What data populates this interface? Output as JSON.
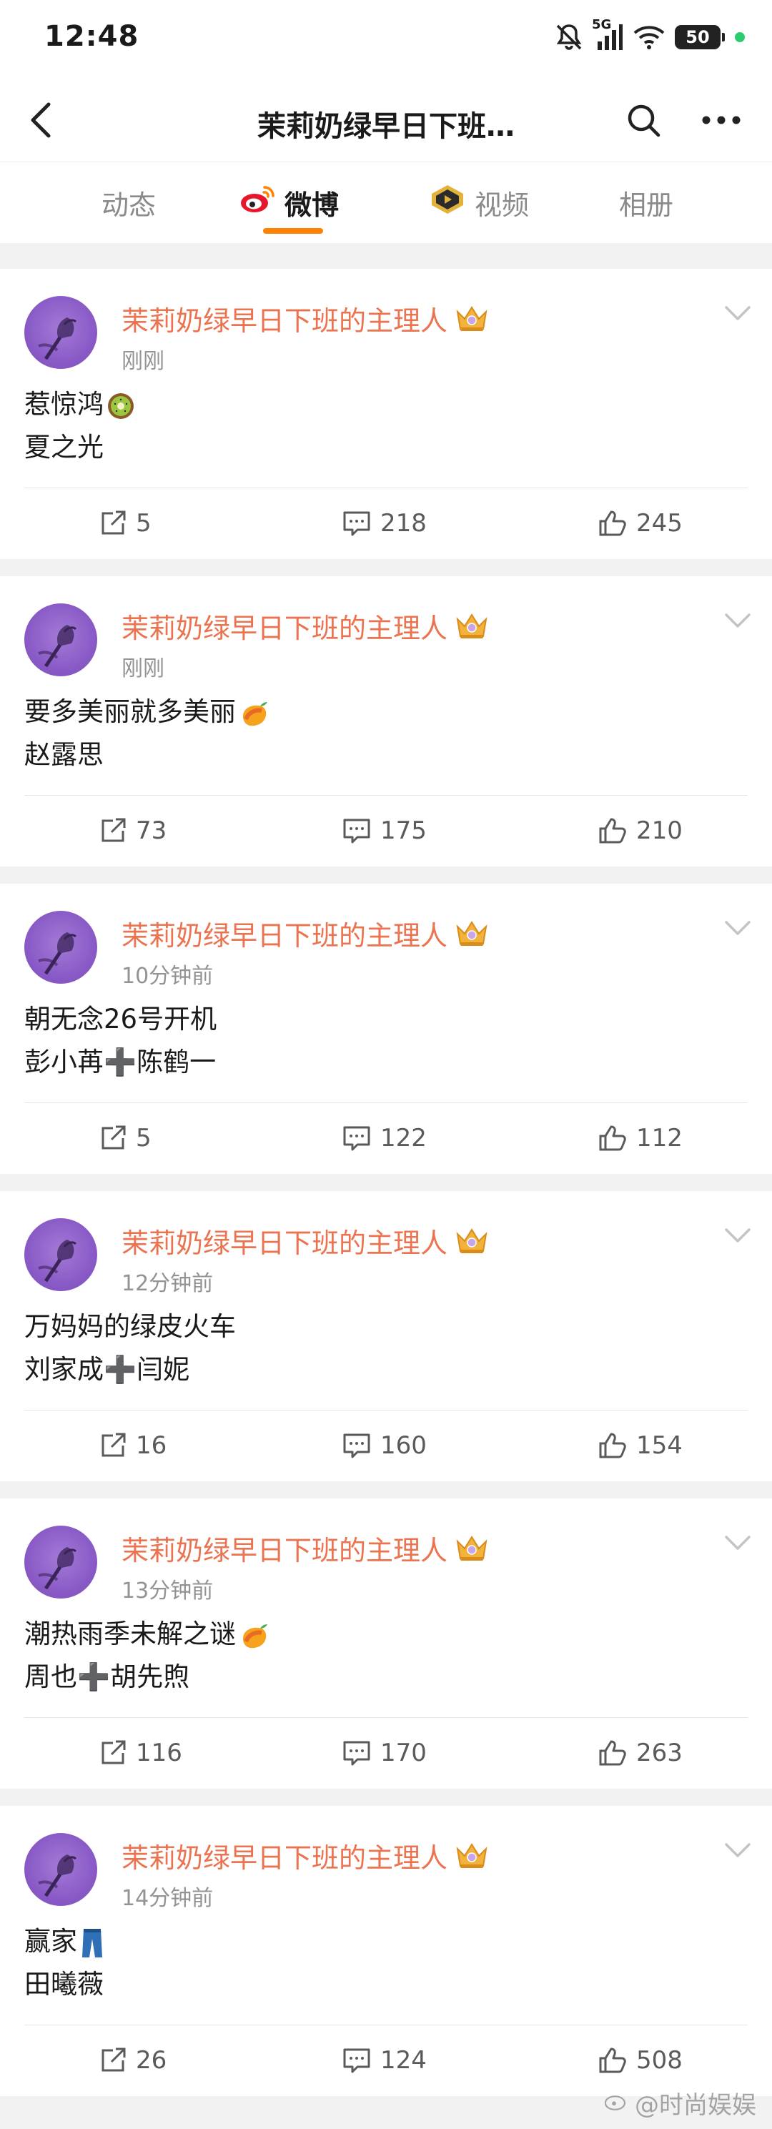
{
  "status_bar": {
    "time": "12:48",
    "network": "5G",
    "battery": "50",
    "icons": [
      "mute-icon",
      "signal-icon",
      "wifi-icon",
      "battery-icon"
    ]
  },
  "nav": {
    "title": "茉莉奶绿早日下班…",
    "icons": [
      "back-icon",
      "search-icon",
      "more-icon"
    ]
  },
  "tabs": [
    {
      "label": "动态",
      "active": false
    },
    {
      "label": "微博",
      "active": true,
      "icon": "weibo-icon"
    },
    {
      "label": "视频",
      "active": false,
      "icon": "video-icon"
    },
    {
      "label": "相册",
      "active": false
    }
  ],
  "colors": {
    "accent": "#ff8200",
    "author": "#eb7350",
    "meta": "#939393",
    "background": "#f2f2f2"
  },
  "posts": [
    {
      "author": "茉莉奶绿早日下班的主理人",
      "time": "刚刚",
      "lines": [
        "惹惊鸿",
        "夏之光"
      ],
      "emoji": [
        "kiwi-emoji",
        ""
      ],
      "reposts": "5",
      "comments": "218",
      "likes": "245"
    },
    {
      "author": "茉莉奶绿早日下班的主理人",
      "time": "刚刚",
      "lines": [
        "要多美丽就多美丽",
        "赵露思"
      ],
      "emoji": [
        "mango-emoji",
        ""
      ],
      "reposts": "73",
      "comments": "175",
      "likes": "210"
    },
    {
      "author": "茉莉奶绿早日下班的主理人",
      "time": "10分钟前",
      "lines": [
        "朝无念26号开机",
        "彭小苒➕陈鹤一"
      ],
      "emoji": [
        "",
        ""
      ],
      "reposts": "5",
      "comments": "122",
      "likes": "112"
    },
    {
      "author": "茉莉奶绿早日下班的主理人",
      "time": "12分钟前",
      "lines": [
        "万妈妈的绿皮火车",
        "刘家成➕闫妮"
      ],
      "emoji": [
        "",
        ""
      ],
      "reposts": "16",
      "comments": "160",
      "likes": "154"
    },
    {
      "author": "茉莉奶绿早日下班的主理人",
      "time": "13分钟前",
      "lines": [
        "潮热雨季未解之谜",
        "周也➕胡先煦"
      ],
      "emoji": [
        "mango-emoji",
        ""
      ],
      "reposts": "116",
      "comments": "170",
      "likes": "263"
    },
    {
      "author": "茉莉奶绿早日下班的主理人",
      "time": "14分钟前",
      "lines": [
        "赢家",
        "田曦薇"
      ],
      "emoji": [
        "jeans-emoji",
        ""
      ],
      "reposts": "26",
      "comments": "124",
      "likes": "508"
    }
  ],
  "watermark": "@时尚娱娱"
}
